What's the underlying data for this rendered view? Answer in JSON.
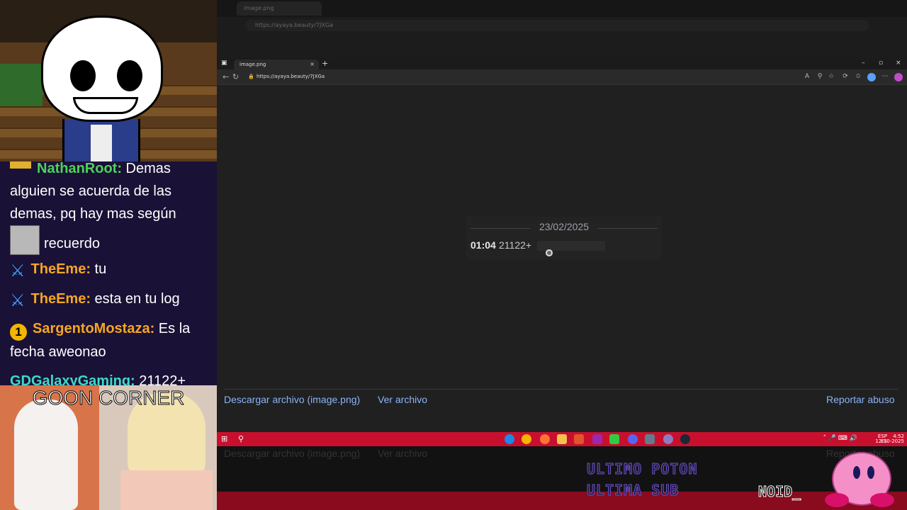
{
  "chat": {
    "messages": [
      {
        "user": "NathanRoot:",
        "text": " Demas",
        "line2": "alguien se acuerda de las",
        "line3": "demas, pq hay mas según",
        "line4": "recuerdo"
      },
      {
        "user": "TheEme:",
        "text": " tu"
      },
      {
        "user": "TheEme:",
        "text": " esta en tu log"
      },
      {
        "user": "SargentoMostaza:",
        "text": " Es la",
        "line2": "fecha aweonao",
        "badge": "1"
      },
      {
        "user": "GDGalaxyGaming:",
        "text": " 21122+"
      }
    ]
  },
  "goon_panel": {
    "title": "GOON CORNER"
  },
  "background_browser": {
    "tab_title": "image.png",
    "url": "https://ayaya.beauty/7JXGa"
  },
  "browser": {
    "tab_title": "image.png",
    "url": "https://ayaya.beauty/7JXGa",
    "new_tab": "+",
    "close_tab": "×",
    "win_min": "–",
    "win_max": "▫",
    "win_close": "×"
  },
  "preview": {
    "date": "23/02/2025",
    "time": "01:04",
    "message": "21122+"
  },
  "footer": {
    "download": "Descargar archivo (image.png)",
    "view": "Ver archivo",
    "report": "Reportar abuso"
  },
  "taskbar": {
    "tray_lang": "ESP",
    "tray_region": "ES",
    "tray_time": "4:52",
    "tray_date": "12-10-2025"
  },
  "ghost": {
    "download": "Descargar archivo (image.png)",
    "view": "Ver archivo",
    "report": "Reportar abuso"
  },
  "stream_overlay": {
    "line1": "ULTIMO POTON",
    "line2": "ULTIMA SUB",
    "tag": "NOID_"
  },
  "colors": {
    "link": "#8ab4f8",
    "taskbar": "#c8102e",
    "chat_bg": "#1a1136"
  }
}
